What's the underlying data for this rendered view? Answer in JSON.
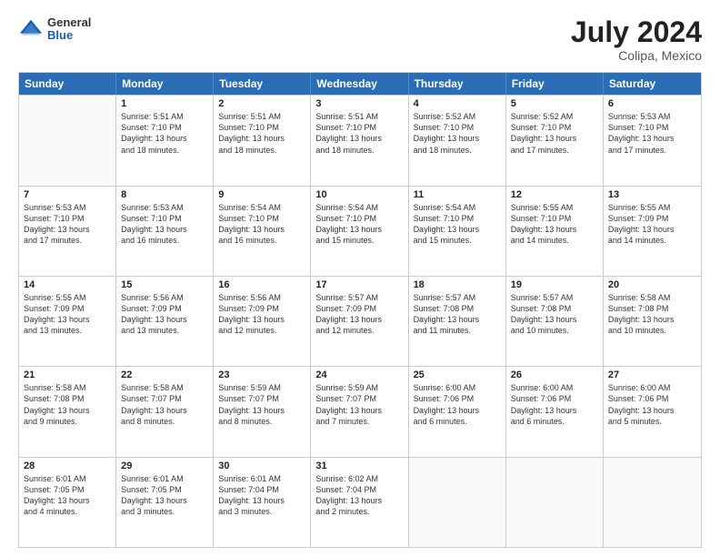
{
  "header": {
    "logo_general": "General",
    "logo_blue": "Blue",
    "title": "July 2024",
    "location": "Colipa, Mexico"
  },
  "weekdays": [
    "Sunday",
    "Monday",
    "Tuesday",
    "Wednesday",
    "Thursday",
    "Friday",
    "Saturday"
  ],
  "rows": [
    [
      {
        "day": "",
        "empty": true
      },
      {
        "day": "1",
        "sunrise": "5:51 AM",
        "sunset": "7:10 PM",
        "daylight": "13 hours and 18 minutes."
      },
      {
        "day": "2",
        "sunrise": "5:51 AM",
        "sunset": "7:10 PM",
        "daylight": "13 hours and 18 minutes."
      },
      {
        "day": "3",
        "sunrise": "5:51 AM",
        "sunset": "7:10 PM",
        "daylight": "13 hours and 18 minutes."
      },
      {
        "day": "4",
        "sunrise": "5:52 AM",
        "sunset": "7:10 PM",
        "daylight": "13 hours and 18 minutes."
      },
      {
        "day": "5",
        "sunrise": "5:52 AM",
        "sunset": "7:10 PM",
        "daylight": "13 hours and 17 minutes."
      },
      {
        "day": "6",
        "sunrise": "5:53 AM",
        "sunset": "7:10 PM",
        "daylight": "13 hours and 17 minutes."
      }
    ],
    [
      {
        "day": "7",
        "sunrise": "5:53 AM",
        "sunset": "7:10 PM",
        "daylight": "13 hours and 17 minutes."
      },
      {
        "day": "8",
        "sunrise": "5:53 AM",
        "sunset": "7:10 PM",
        "daylight": "13 hours and 16 minutes."
      },
      {
        "day": "9",
        "sunrise": "5:54 AM",
        "sunset": "7:10 PM",
        "daylight": "13 hours and 16 minutes."
      },
      {
        "day": "10",
        "sunrise": "5:54 AM",
        "sunset": "7:10 PM",
        "daylight": "13 hours and 15 minutes."
      },
      {
        "day": "11",
        "sunrise": "5:54 AM",
        "sunset": "7:10 PM",
        "daylight": "13 hours and 15 minutes."
      },
      {
        "day": "12",
        "sunrise": "5:55 AM",
        "sunset": "7:10 PM",
        "daylight": "13 hours and 14 minutes."
      },
      {
        "day": "13",
        "sunrise": "5:55 AM",
        "sunset": "7:09 PM",
        "daylight": "13 hours and 14 minutes."
      }
    ],
    [
      {
        "day": "14",
        "sunrise": "5:55 AM",
        "sunset": "7:09 PM",
        "daylight": "13 hours and 13 minutes."
      },
      {
        "day": "15",
        "sunrise": "5:56 AM",
        "sunset": "7:09 PM",
        "daylight": "13 hours and 13 minutes."
      },
      {
        "day": "16",
        "sunrise": "5:56 AM",
        "sunset": "7:09 PM",
        "daylight": "13 hours and 12 minutes."
      },
      {
        "day": "17",
        "sunrise": "5:57 AM",
        "sunset": "7:09 PM",
        "daylight": "13 hours and 12 minutes."
      },
      {
        "day": "18",
        "sunrise": "5:57 AM",
        "sunset": "7:08 PM",
        "daylight": "13 hours and 11 minutes."
      },
      {
        "day": "19",
        "sunrise": "5:57 AM",
        "sunset": "7:08 PM",
        "daylight": "13 hours and 10 minutes."
      },
      {
        "day": "20",
        "sunrise": "5:58 AM",
        "sunset": "7:08 PM",
        "daylight": "13 hours and 10 minutes."
      }
    ],
    [
      {
        "day": "21",
        "sunrise": "5:58 AM",
        "sunset": "7:08 PM",
        "daylight": "13 hours and 9 minutes."
      },
      {
        "day": "22",
        "sunrise": "5:58 AM",
        "sunset": "7:07 PM",
        "daylight": "13 hours and 8 minutes."
      },
      {
        "day": "23",
        "sunrise": "5:59 AM",
        "sunset": "7:07 PM",
        "daylight": "13 hours and 8 minutes."
      },
      {
        "day": "24",
        "sunrise": "5:59 AM",
        "sunset": "7:07 PM",
        "daylight": "13 hours and 7 minutes."
      },
      {
        "day": "25",
        "sunrise": "6:00 AM",
        "sunset": "7:06 PM",
        "daylight": "13 hours and 6 minutes."
      },
      {
        "day": "26",
        "sunrise": "6:00 AM",
        "sunset": "7:06 PM",
        "daylight": "13 hours and 6 minutes."
      },
      {
        "day": "27",
        "sunrise": "6:00 AM",
        "sunset": "7:06 PM",
        "daylight": "13 hours and 5 minutes."
      }
    ],
    [
      {
        "day": "28",
        "sunrise": "6:01 AM",
        "sunset": "7:05 PM",
        "daylight": "13 hours and 4 minutes."
      },
      {
        "day": "29",
        "sunrise": "6:01 AM",
        "sunset": "7:05 PM",
        "daylight": "13 hours and 3 minutes."
      },
      {
        "day": "30",
        "sunrise": "6:01 AM",
        "sunset": "7:04 PM",
        "daylight": "13 hours and 3 minutes."
      },
      {
        "day": "31",
        "sunrise": "6:02 AM",
        "sunset": "7:04 PM",
        "daylight": "13 hours and 2 minutes."
      },
      {
        "day": "",
        "empty": true
      },
      {
        "day": "",
        "empty": true
      },
      {
        "day": "",
        "empty": true
      }
    ]
  ]
}
